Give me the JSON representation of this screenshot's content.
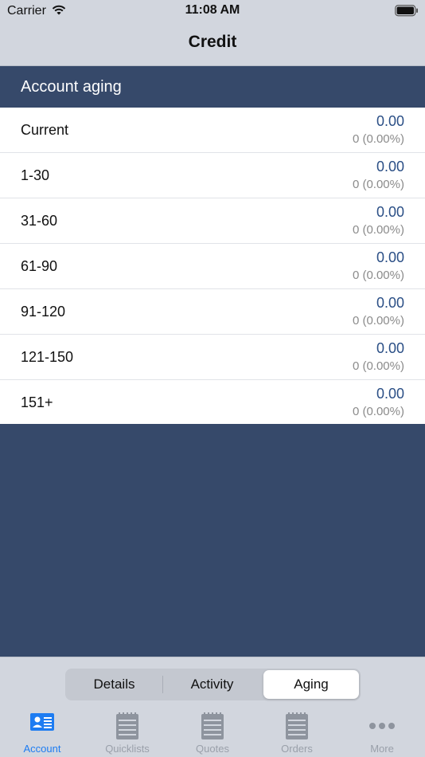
{
  "status_bar": {
    "carrier": "Carrier",
    "time": "11:08 AM",
    "icons": [
      "wifi-icon",
      "battery-icon"
    ]
  },
  "nav": {
    "title": "Credit"
  },
  "section": {
    "title": "Account aging"
  },
  "aging_rows": [
    {
      "label": "Current",
      "amount": "0.00",
      "detail": "0 (0.00%)"
    },
    {
      "label": "1-30",
      "amount": "0.00",
      "detail": "0 (0.00%)"
    },
    {
      "label": "31-60",
      "amount": "0.00",
      "detail": "0 (0.00%)"
    },
    {
      "label": "61-90",
      "amount": "0.00",
      "detail": "0 (0.00%)"
    },
    {
      "label": "91-120",
      "amount": "0.00",
      "detail": "0 (0.00%)"
    },
    {
      "label": "121-150",
      "amount": "0.00",
      "detail": "0 (0.00%)"
    },
    {
      "label": "151+",
      "amount": "0.00",
      "detail": "0 (0.00%)"
    }
  ],
  "segments": {
    "items": [
      "Details",
      "Activity",
      "Aging"
    ],
    "selected": "Aging"
  },
  "tabs": [
    {
      "label": "Account",
      "icon": "account-card-icon",
      "active": true
    },
    {
      "label": "Quicklists",
      "icon": "notepad-icon",
      "active": false
    },
    {
      "label": "Quotes",
      "icon": "notepad-icon",
      "active": false
    },
    {
      "label": "Orders",
      "icon": "notepad-icon",
      "active": false
    },
    {
      "label": "More",
      "icon": "more-dots-icon",
      "active": false
    }
  ],
  "colors": {
    "header_bg": "#36496a",
    "bar_bg": "#d2d6de",
    "amount_text": "#2b4f86",
    "active_tab": "#1d7cf2",
    "inactive_tab": "#9aa0aa"
  }
}
